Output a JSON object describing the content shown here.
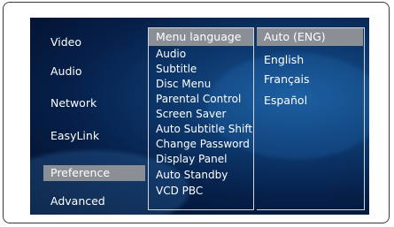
{
  "menu": {
    "categories": [
      {
        "label": "Video"
      },
      {
        "label": "Audio"
      },
      {
        "label": "Network"
      },
      {
        "label": "EasyLink"
      },
      {
        "label": "Preference"
      },
      {
        "label": "Advanced"
      }
    ],
    "selected_category": "Preference",
    "options": [
      {
        "label": "Menu language"
      },
      {
        "label": "Audio"
      },
      {
        "label": "Subtitle"
      },
      {
        "label": "Disc Menu"
      },
      {
        "label": "Parental Control"
      },
      {
        "label": "Screen Saver"
      },
      {
        "label": "Auto Subtitle Shift"
      },
      {
        "label": "Change Password"
      },
      {
        "label": "Display Panel"
      },
      {
        "label": "Auto Standby"
      },
      {
        "label": "VCD PBC"
      }
    ],
    "selected_option": "Menu language",
    "values": [
      {
        "label": "Auto (ENG)"
      },
      {
        "label": "English"
      },
      {
        "label": "Français"
      },
      {
        "label": "Español"
      }
    ],
    "selected_value": "Auto (ENG)"
  },
  "colors": {
    "highlight": "#8a8f96",
    "text": "#ffffff",
    "background": "#0d3a70"
  }
}
